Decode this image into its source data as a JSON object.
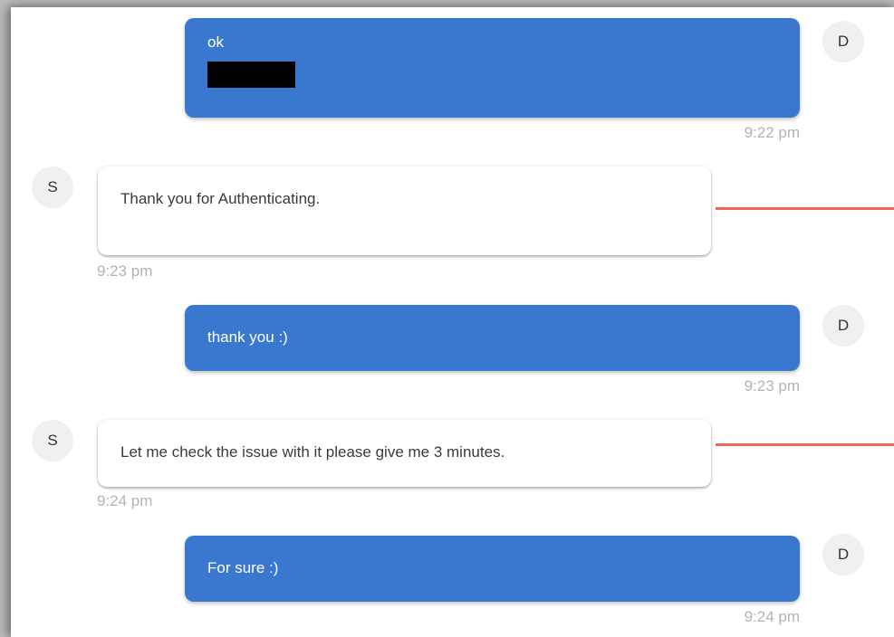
{
  "messages": [
    {
      "sender": "D",
      "text": "ok",
      "time": "9:22 pm"
    },
    {
      "sender": "S",
      "text": "Thank you for Authenticating.",
      "time": "9:23 pm"
    },
    {
      "sender": "D",
      "text": "thank you :)",
      "time": "9:23 pm"
    },
    {
      "sender": "S",
      "text": "Let me check the issue with it please give me 3 minutes.",
      "time": "9:24 pm"
    },
    {
      "sender": "D",
      "text": "For sure :)",
      "time": "9:24 pm"
    }
  ],
  "colors": {
    "outgoing_bubble": "#3a78d0",
    "incoming_bubble": "#ffffff",
    "annotation_line": "#f26453",
    "timestamp": "#b3b3b3"
  }
}
